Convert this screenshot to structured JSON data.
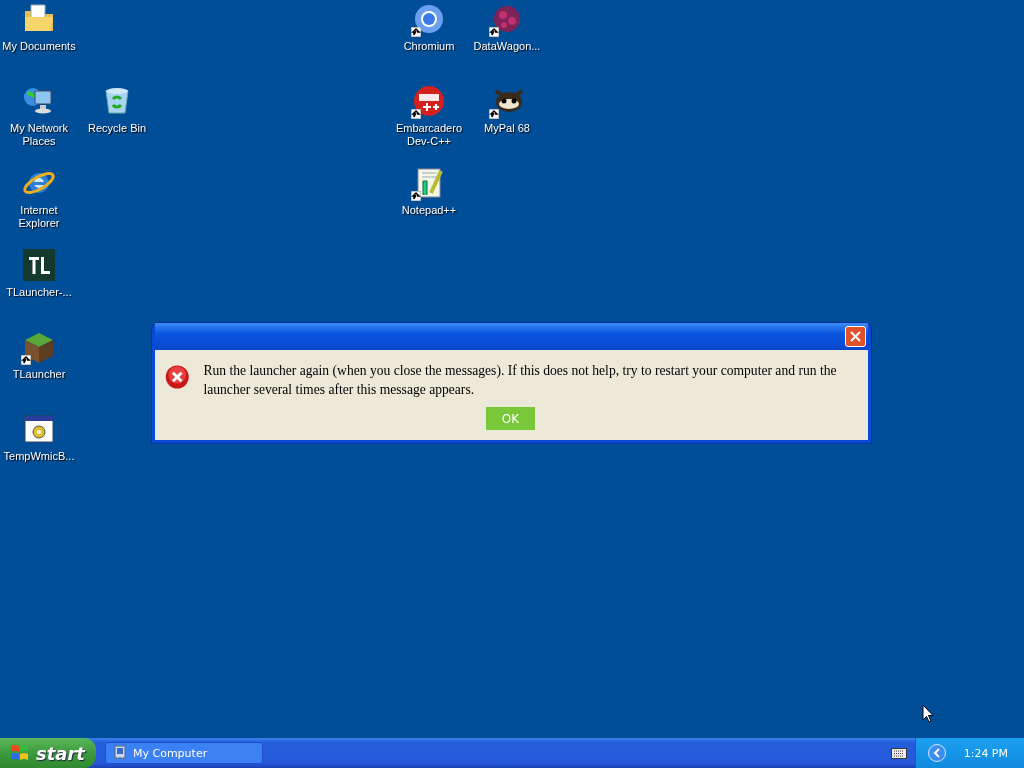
{
  "desktop_icons": [
    {
      "label": "My Documents",
      "shortcut": false
    },
    {
      "label": "My Network Places",
      "shortcut": false
    },
    {
      "label": "Recycle Bin",
      "shortcut": false
    },
    {
      "label": "Internet Explorer",
      "shortcut": false
    },
    {
      "label": "TLauncher-...",
      "shortcut": false
    },
    {
      "label": "TLauncher",
      "shortcut": true
    },
    {
      "label": "TempWmicB...",
      "shortcut": false
    },
    {
      "label": "Chromium",
      "shortcut": true
    },
    {
      "label": "DataWagon...",
      "shortcut": true
    },
    {
      "label": "Embarcadero Dev-C++",
      "shortcut": true
    },
    {
      "label": "MyPal 68",
      "shortcut": true
    },
    {
      "label": "Notepad++",
      "shortcut": true
    }
  ],
  "dialog": {
    "message": "Run the launcher again (when you close the messages). If this does not help, try to restart your computer and run the launcher several times after this message appears.",
    "button": "OK"
  },
  "taskbar": {
    "start": "start",
    "tasks": [
      {
        "label": "My Computer",
        "selected": false
      }
    ],
    "clock": "1:24 PM"
  }
}
